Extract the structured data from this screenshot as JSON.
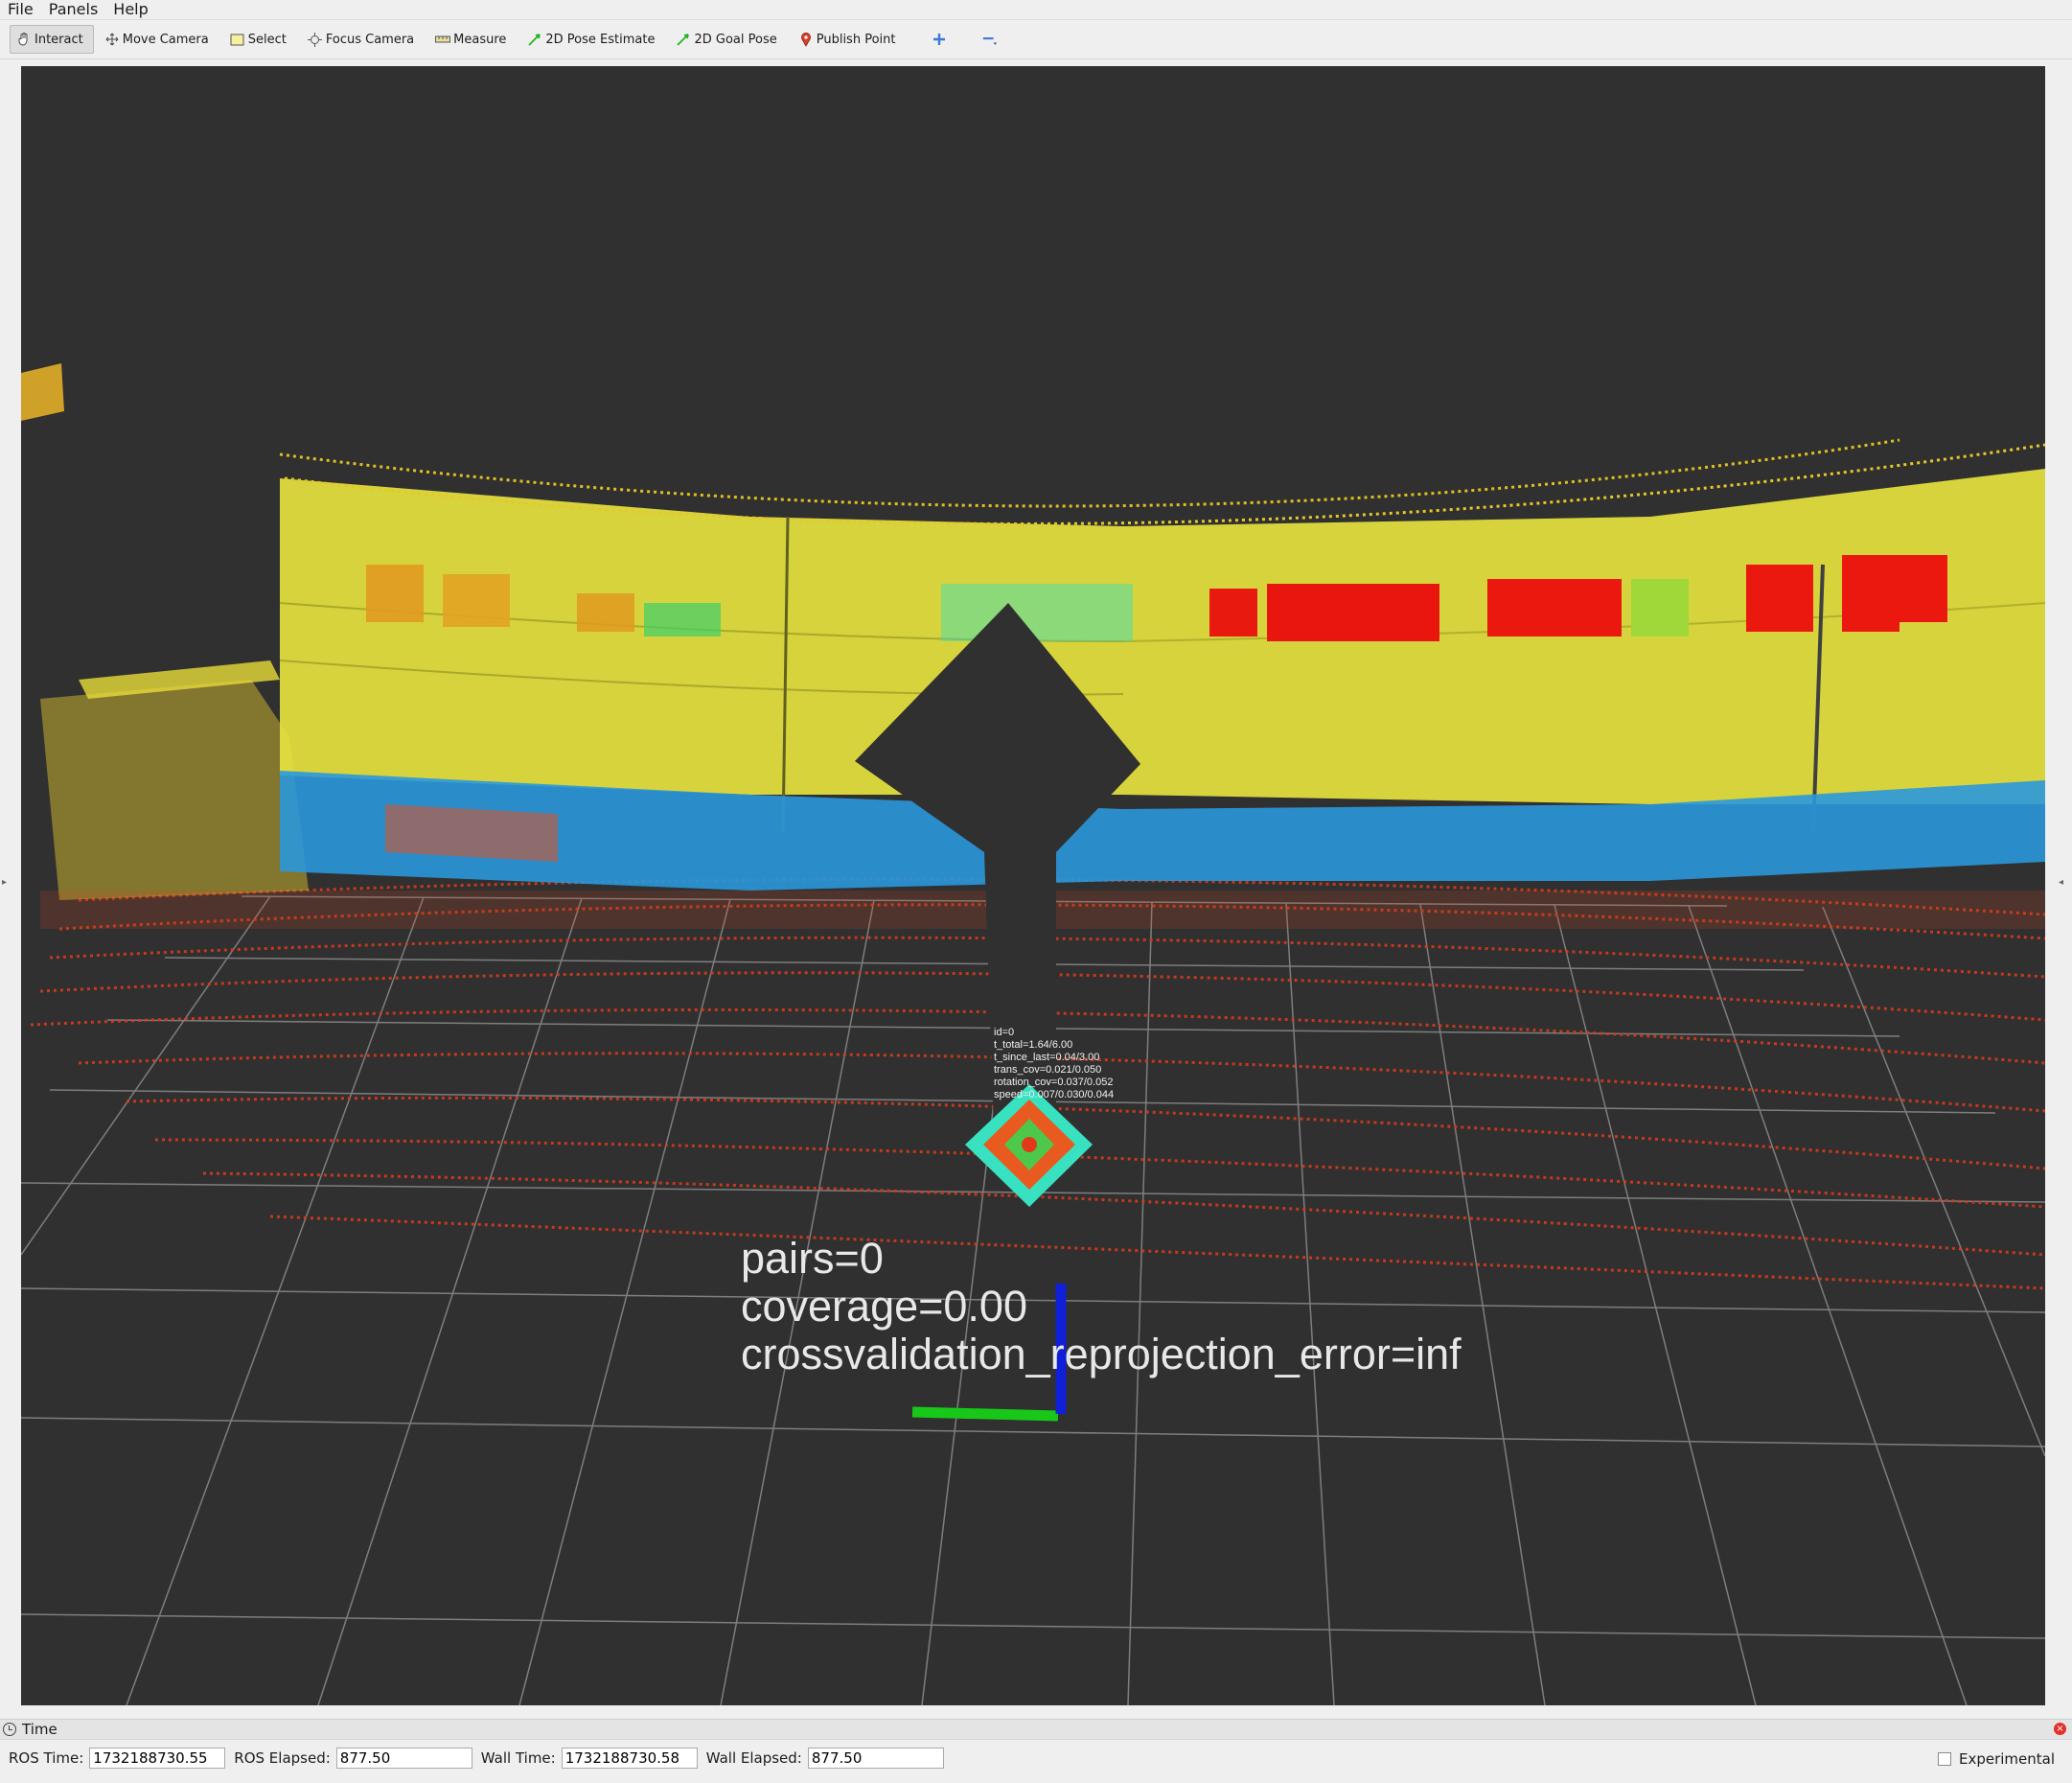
{
  "menu": [
    {
      "label": "File"
    },
    {
      "label": "Panels"
    },
    {
      "label": "Help"
    }
  ],
  "toolbar": {
    "tools": [
      {
        "label": "Interact",
        "icon": "hand-icon",
        "active": true
      },
      {
        "label": "Move Camera",
        "icon": "move-camera-icon"
      },
      {
        "label": "Select",
        "icon": "select-icon"
      },
      {
        "label": "Focus Camera",
        "icon": "focus-camera-icon"
      },
      {
        "label": "Measure",
        "icon": "ruler-icon"
      },
      {
        "label": "2D Pose Estimate",
        "icon": "pose-arrow-icon"
      },
      {
        "label": "2D Goal Pose",
        "icon": "goal-arrow-icon"
      },
      {
        "label": "Publish Point",
        "icon": "map-pin-icon"
      }
    ],
    "add_icon": "plus-icon",
    "remove_icon": "minus-icon"
  },
  "viewport": {
    "background": "#303030",
    "marker_small": [
      "id=0",
      "t_total=1.64/6.00",
      "t_since_last=0.04/3.00",
      "trans_cov=0.021/0.050",
      "rotation_cov=0.037/0.052",
      "speed=0.007/0.030/0.044"
    ],
    "marker_big": [
      "pairs=0",
      "coverage=0.00",
      "crossvalidation_reprojection_error=inf"
    ],
    "axis_colors": {
      "x_axis": "#18c818",
      "z_axis": "#1020d8"
    }
  },
  "time_panel": {
    "title": "Time",
    "ros_time_label": "ROS Time:",
    "ros_time": "1732188730.55",
    "ros_elapsed_label": "ROS Elapsed:",
    "ros_elapsed": "877.50",
    "wall_time_label": "Wall Time:",
    "wall_time": "1732188730.58",
    "wall_elapsed_label": "Wall Elapsed:",
    "wall_elapsed": "877.50",
    "experimental_label": "Experimental"
  }
}
